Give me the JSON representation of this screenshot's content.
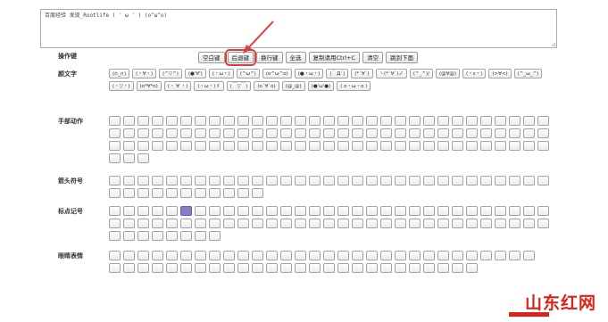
{
  "textarea": {
    "value": "百度经验 发现_Rootlife ( ' ω ' ) (o^ω^o)"
  },
  "operations": {
    "label": "操作键",
    "buttons": [
      "空白键",
      "后退键",
      "换行键",
      "全选",
      "复制请用Ctrl+C",
      "清空",
      "跳到下面"
    ],
    "highlighted": "后退键"
  },
  "sections": [
    {
      "label": "颜文字",
      "items": [
        "(∩_∩)",
        "(・∀・)",
        "(^▽^)",
        "(●'∀')",
        "(・ω・)",
        "(^ω^)",
        "(o^ω^o)",
        "(●・ω・)",
        "(｀Д´)",
        "(*´∀`)",
        "ヽ(*´∀`)ノ",
        "(^_^)/",
        "(@∀@)",
        "(・ε・)",
        "(>∀<)",
        "(^_ω_^)",
        "(・▽・)",
        "(o*∀*o)",
        "(・ ∀ ・)",
        "(・ω・)ゞ",
        "(￣▽￣)",
        "(o´∀`o)",
        "(@_@)",
        "(●'ω'●)",
        "( o・ω・o )"
      ]
    },
    {
      "label": "手部动作",
      "count": 96
    },
    {
      "label": "箭头符号",
      "count": 42
    },
    {
      "label": "标点记号",
      "count": 70
    },
    {
      "label": "眼睛表情",
      "count": 56
    }
  ],
  "watermark": {
    "text": "山东红网"
  },
  "colors": {
    "highlight": "#e23b3b",
    "accent": "#8b7cc7",
    "watermark": "#d9221c"
  }
}
